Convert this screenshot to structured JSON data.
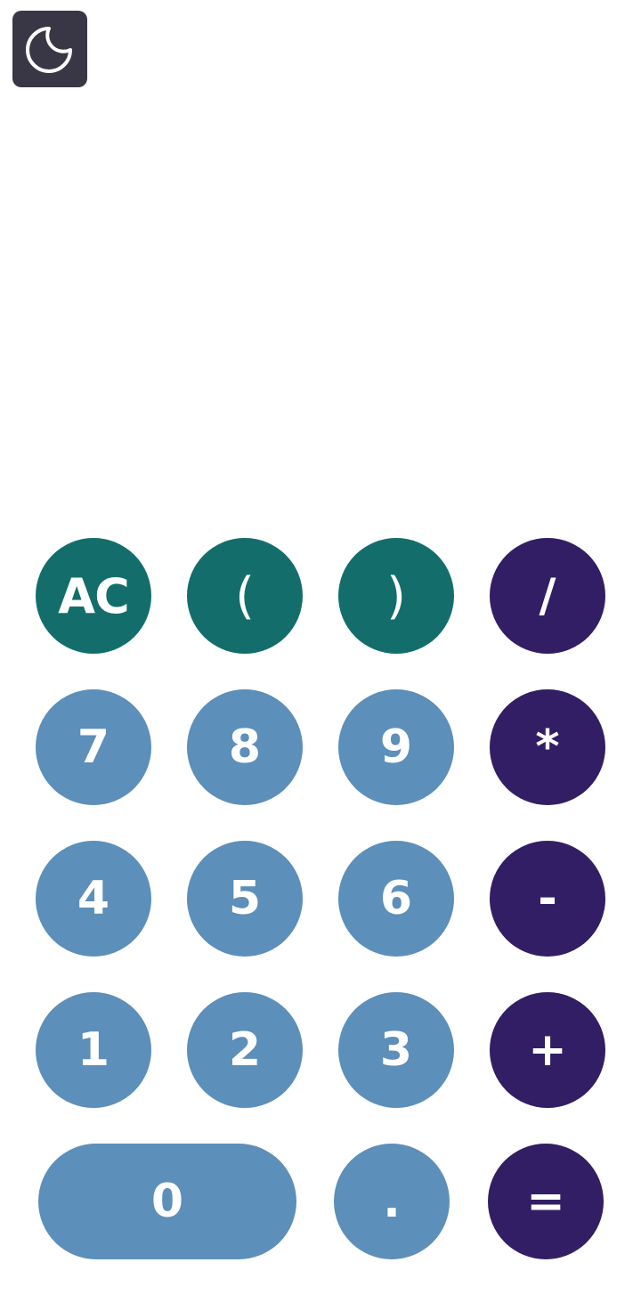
{
  "theme_toggle": {
    "icon": "moon-icon"
  },
  "display": {
    "expression": ""
  },
  "colors": {
    "function_keys": "#136e6b",
    "digit_keys": "#5c8fb9",
    "operator_keys": "#321e64",
    "toggle_background": "#393645"
  },
  "keypad": {
    "clear": "AC",
    "open_paren": "(",
    "close_paren": ")",
    "divide": "/",
    "multiply": "*",
    "subtract": "-",
    "add": "+",
    "equals": "=",
    "decimal": ".",
    "digits": {
      "zero": "0",
      "one": "1",
      "two": "2",
      "three": "3",
      "four": "4",
      "five": "5",
      "six": "6",
      "seven": "7",
      "eight": "8",
      "nine": "9"
    }
  }
}
